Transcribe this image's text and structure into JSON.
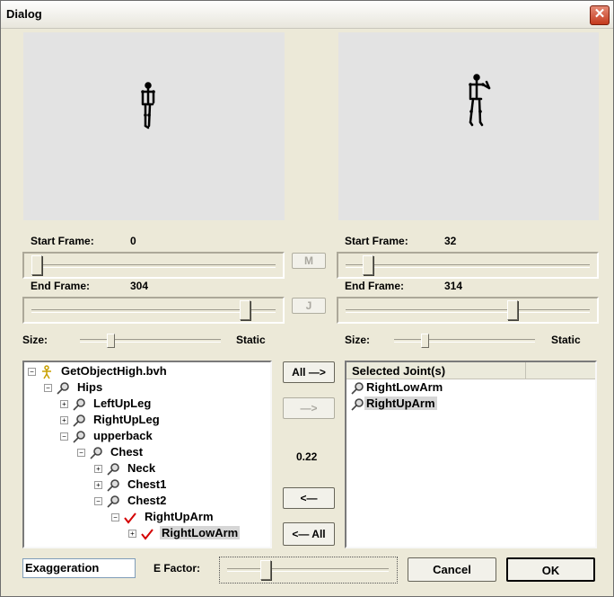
{
  "window": {
    "title": "Dialog",
    "close_symbol": "✕"
  },
  "left": {
    "start_frame_label": "Start Frame:",
    "start_frame_value": "0",
    "end_frame_label": "End Frame:",
    "end_frame_value": "304",
    "size_label": "Size:",
    "static_label": "Static"
  },
  "right": {
    "start_frame_label": "Start Frame:",
    "start_frame_value": "32",
    "end_frame_label": "End Frame:",
    "end_frame_value": "314",
    "size_label": "Size:",
    "static_label": "Static"
  },
  "middle": {
    "m_button": "M",
    "j_button": "J",
    "all_right_button": "All —>",
    "right_button": "—>",
    "value": "0.22",
    "left_button": "<—",
    "all_left_button": "<— All"
  },
  "tree": [
    {
      "label": "GetObjectHigh.bvh",
      "icon": "figure-icon"
    },
    {
      "label": "Hips",
      "icon": "joint-icon"
    },
    {
      "label": "LeftUpLeg",
      "icon": "joint-icon"
    },
    {
      "label": "RightUpLeg",
      "icon": "joint-icon"
    },
    {
      "label": "upperback",
      "icon": "joint-icon"
    },
    {
      "label": "Chest",
      "icon": "joint-icon"
    },
    {
      "label": "Neck",
      "icon": "joint-icon"
    },
    {
      "label": "Chest1",
      "icon": "joint-icon"
    },
    {
      "label": "Chest2",
      "icon": "joint-icon"
    },
    {
      "label": "RightUpArm",
      "icon": "check-icon"
    },
    {
      "label": "RightLowArm",
      "icon": "check-icon"
    }
  ],
  "selected_joints": {
    "header": "Selected Joint(s)",
    "items": [
      {
        "label": "RightLowArm"
      },
      {
        "label": "RightUpArm"
      }
    ]
  },
  "bottom": {
    "exaggeration_value": "Exaggeration",
    "efactor_label": "E Factor:",
    "cancel_button": "Cancel",
    "ok_button": "OK"
  },
  "sliders": {
    "left_start": 0.03,
    "left_end": 0.88,
    "right_start": 0.1,
    "right_end": 0.72,
    "left_size": 0.22,
    "right_size": 0.22,
    "efactor": 0.22
  },
  "colors": {
    "accent_check": "#d40000",
    "preview_bg": "#e3e3e3"
  }
}
